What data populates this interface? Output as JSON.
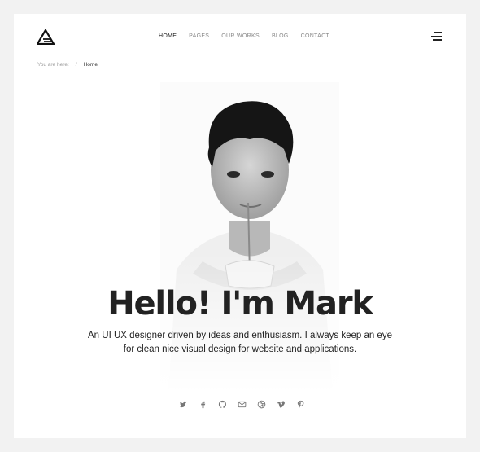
{
  "header": {
    "nav": [
      {
        "label": "HOME",
        "active": true
      },
      {
        "label": "PAGES",
        "active": false
      },
      {
        "label": "OUR WORKS",
        "active": false
      },
      {
        "label": "BLOG",
        "active": false
      },
      {
        "label": "CONTACT",
        "active": false
      }
    ]
  },
  "breadcrumb": {
    "prefix": "You are here:",
    "separator": "/",
    "current": "Home"
  },
  "hero": {
    "title": "Hello! I'm Mark",
    "subtitle": "An UI UX designer driven by ideas and enthusiasm. I always keep an eye for clean nice visual design for website and applications."
  },
  "social": [
    "twitter-icon",
    "facebook-icon",
    "github-icon",
    "mail-icon",
    "dribbble-icon",
    "vimeo-icon",
    "pinterest-icon"
  ],
  "colors": {
    "background": "#f2f2f2",
    "card": "#ffffff",
    "text": "#222222",
    "muted": "#888888"
  }
}
